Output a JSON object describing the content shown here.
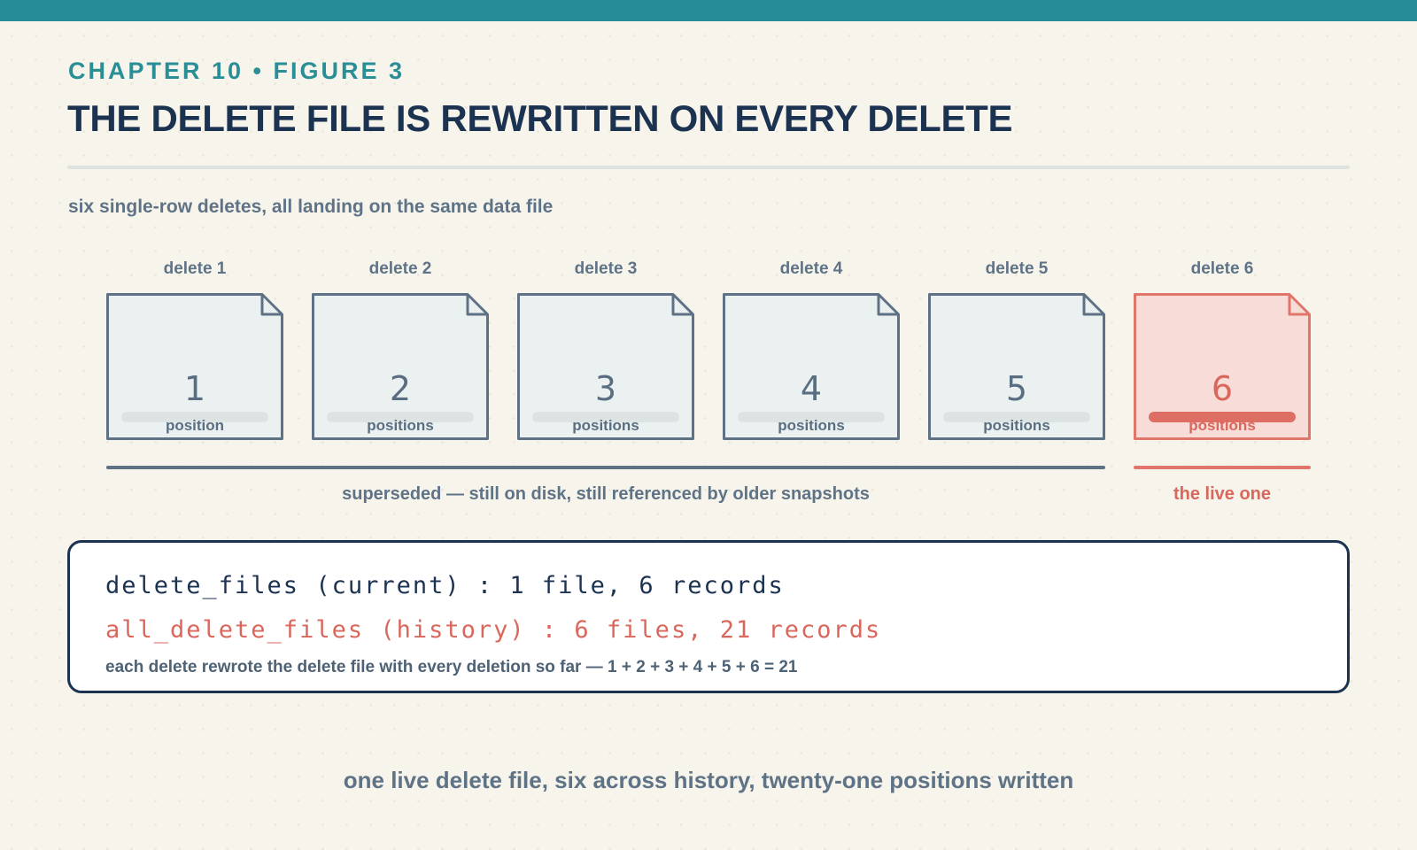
{
  "header": {
    "eyebrow": "CHAPTER 10 • FIGURE 3",
    "title": "THE DELETE FILE IS REWRITTEN ON EVERY DELETE",
    "subtitle": "six single-row deletes, all landing on the same data file"
  },
  "files": [
    {
      "label": "delete 1",
      "count": "1",
      "unit": "position",
      "status": "superseded"
    },
    {
      "label": "delete 2",
      "count": "2",
      "unit": "positions",
      "status": "superseded"
    },
    {
      "label": "delete 3",
      "count": "3",
      "unit": "positions",
      "status": "superseded"
    },
    {
      "label": "delete 4",
      "count": "4",
      "unit": "positions",
      "status": "superseded"
    },
    {
      "label": "delete 5",
      "count": "5",
      "unit": "positions",
      "status": "superseded"
    },
    {
      "label": "delete 6",
      "count": "6",
      "unit": "positions",
      "status": "live"
    }
  ],
  "captions": {
    "superseded": "superseded — still on disk, still referenced by older snapshots",
    "live": "the live one"
  },
  "summary": {
    "current_line": "delete_files (current) : 1 file, 6 records",
    "history_line": "all_delete_files (history) : 6 files, 21 records",
    "note": "each delete rewrote the delete file with every deletion so far — 1 + 2 + 3 + 4 + 5 + 6 = 21"
  },
  "footer": "one live delete file, six across history, twenty-one positions written",
  "colors": {
    "accent": "#258c95",
    "navy": "#1b3251",
    "slate": "#5e7185",
    "coral": "#d9675c",
    "file_fill": "#ebf0f0",
    "live_fill": "#f8dcd7"
  }
}
